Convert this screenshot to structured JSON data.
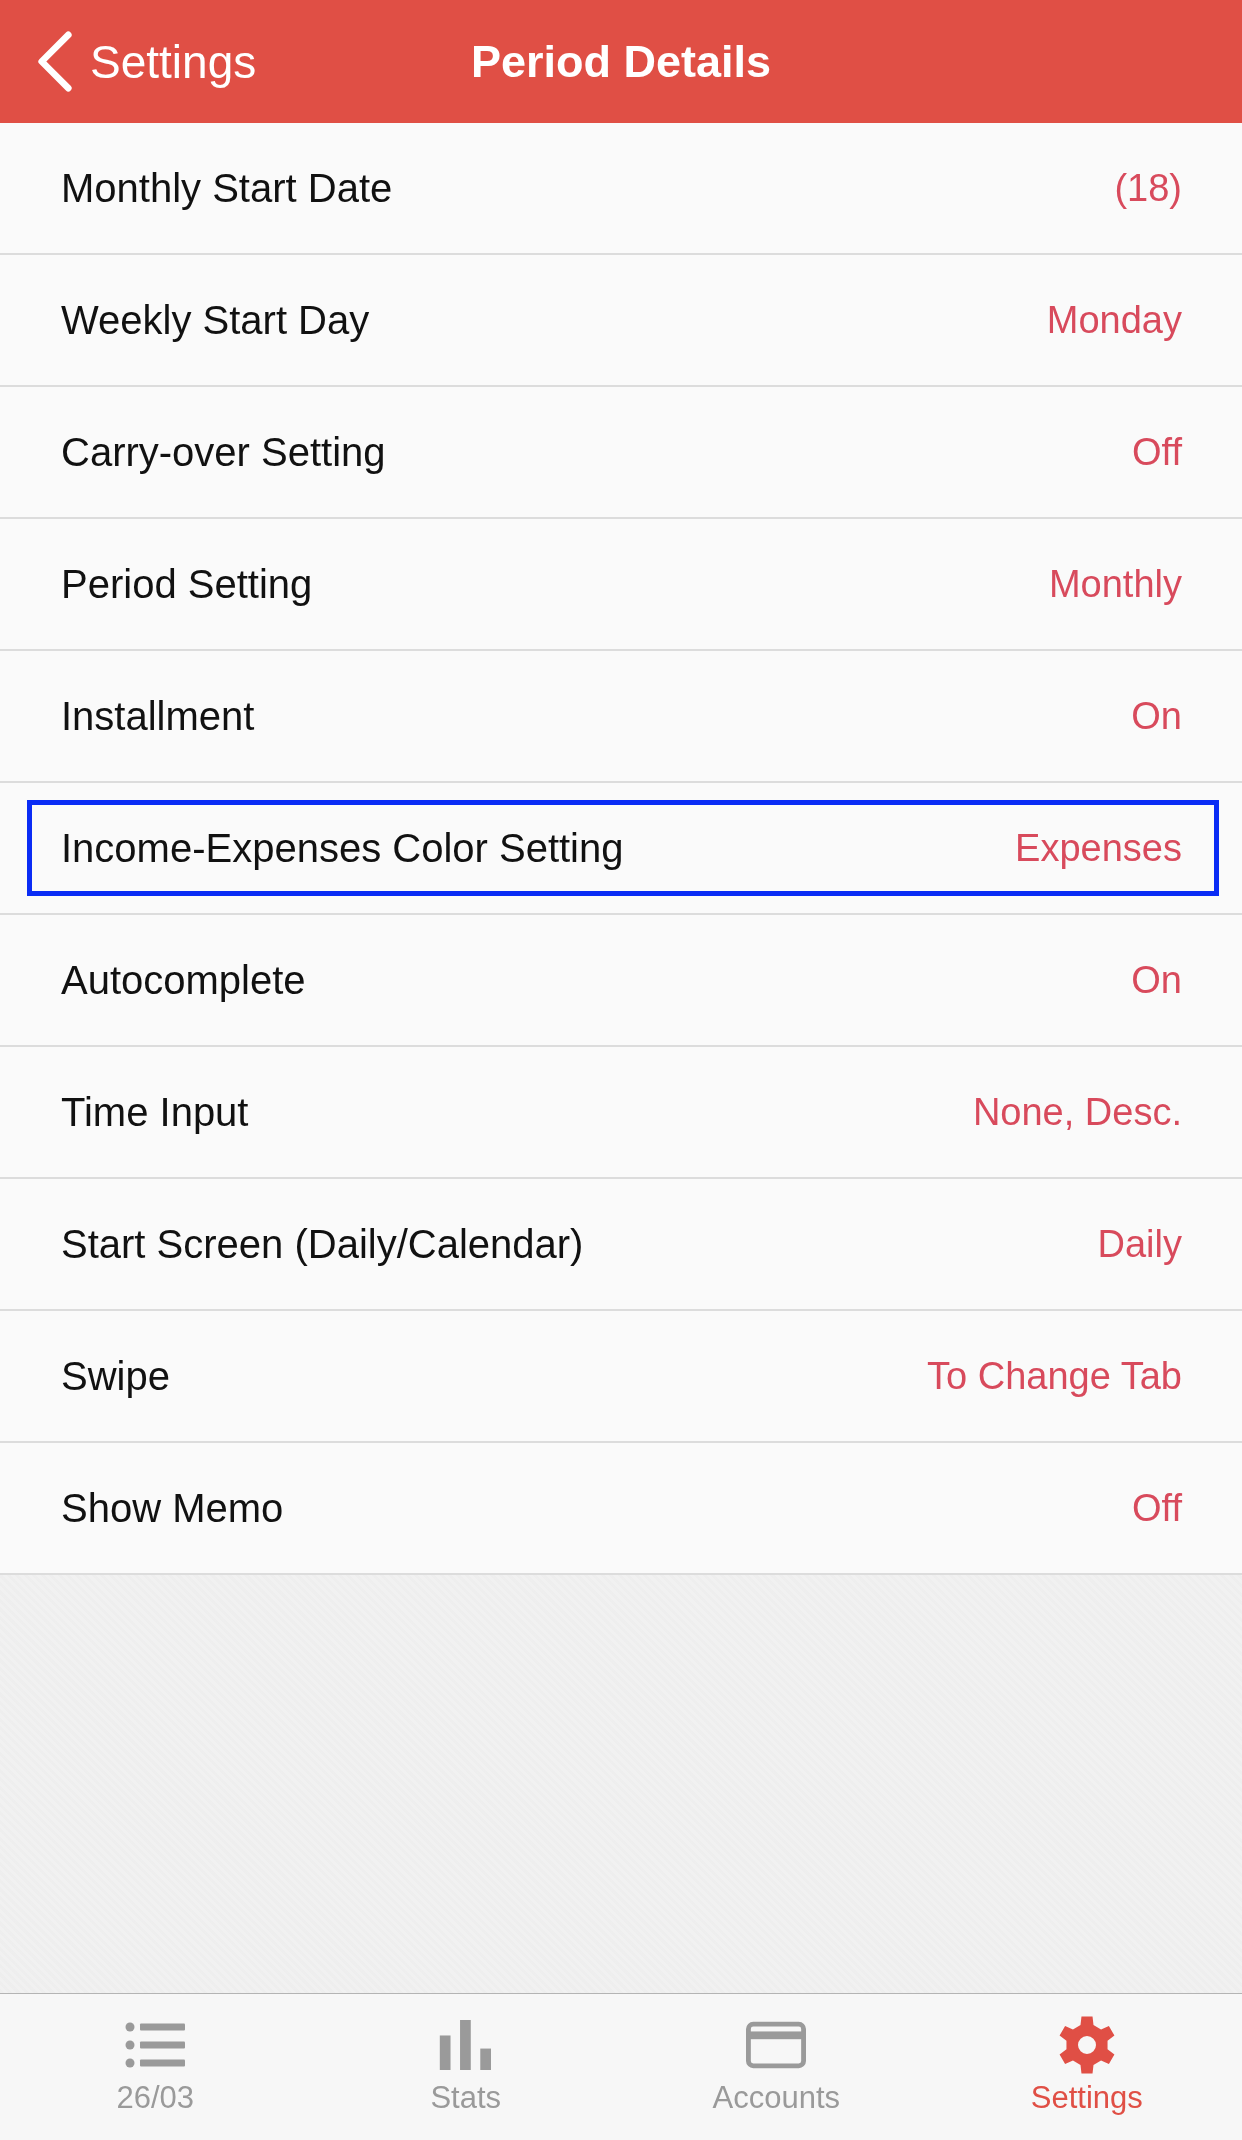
{
  "nav": {
    "back_label": "Settings",
    "title": "Period Details"
  },
  "rows": [
    {
      "label": "Monthly Start Date",
      "value": "(18)",
      "highlighted": false
    },
    {
      "label": "Weekly Start Day",
      "value": "Monday",
      "highlighted": false
    },
    {
      "label": "Carry-over Setting",
      "value": "Off",
      "highlighted": false
    },
    {
      "label": "Period Setting",
      "value": "Monthly",
      "highlighted": false
    },
    {
      "label": "Installment",
      "value": "On",
      "highlighted": false
    },
    {
      "label": "Income-Expenses Color Setting",
      "value": "Expenses",
      "highlighted": true
    },
    {
      "label": "Autocomplete",
      "value": "On",
      "highlighted": false
    },
    {
      "label": "Time Input",
      "value": "None, Desc.",
      "highlighted": false
    },
    {
      "label": "Start Screen (Daily/Calendar)",
      "value": "Daily",
      "highlighted": false
    },
    {
      "label": "Swipe",
      "value": "To Change Tab",
      "highlighted": false
    },
    {
      "label": "Show Memo",
      "value": "Off",
      "highlighted": false
    }
  ],
  "tab_bar": [
    {
      "label": "26/03",
      "kind": "list",
      "selected": false
    },
    {
      "label": "Stats",
      "kind": "chart",
      "selected": false
    },
    {
      "label": "Accounts",
      "kind": "card",
      "selected": false
    },
    {
      "label": "Settings",
      "kind": "gear",
      "selected": true
    }
  ]
}
